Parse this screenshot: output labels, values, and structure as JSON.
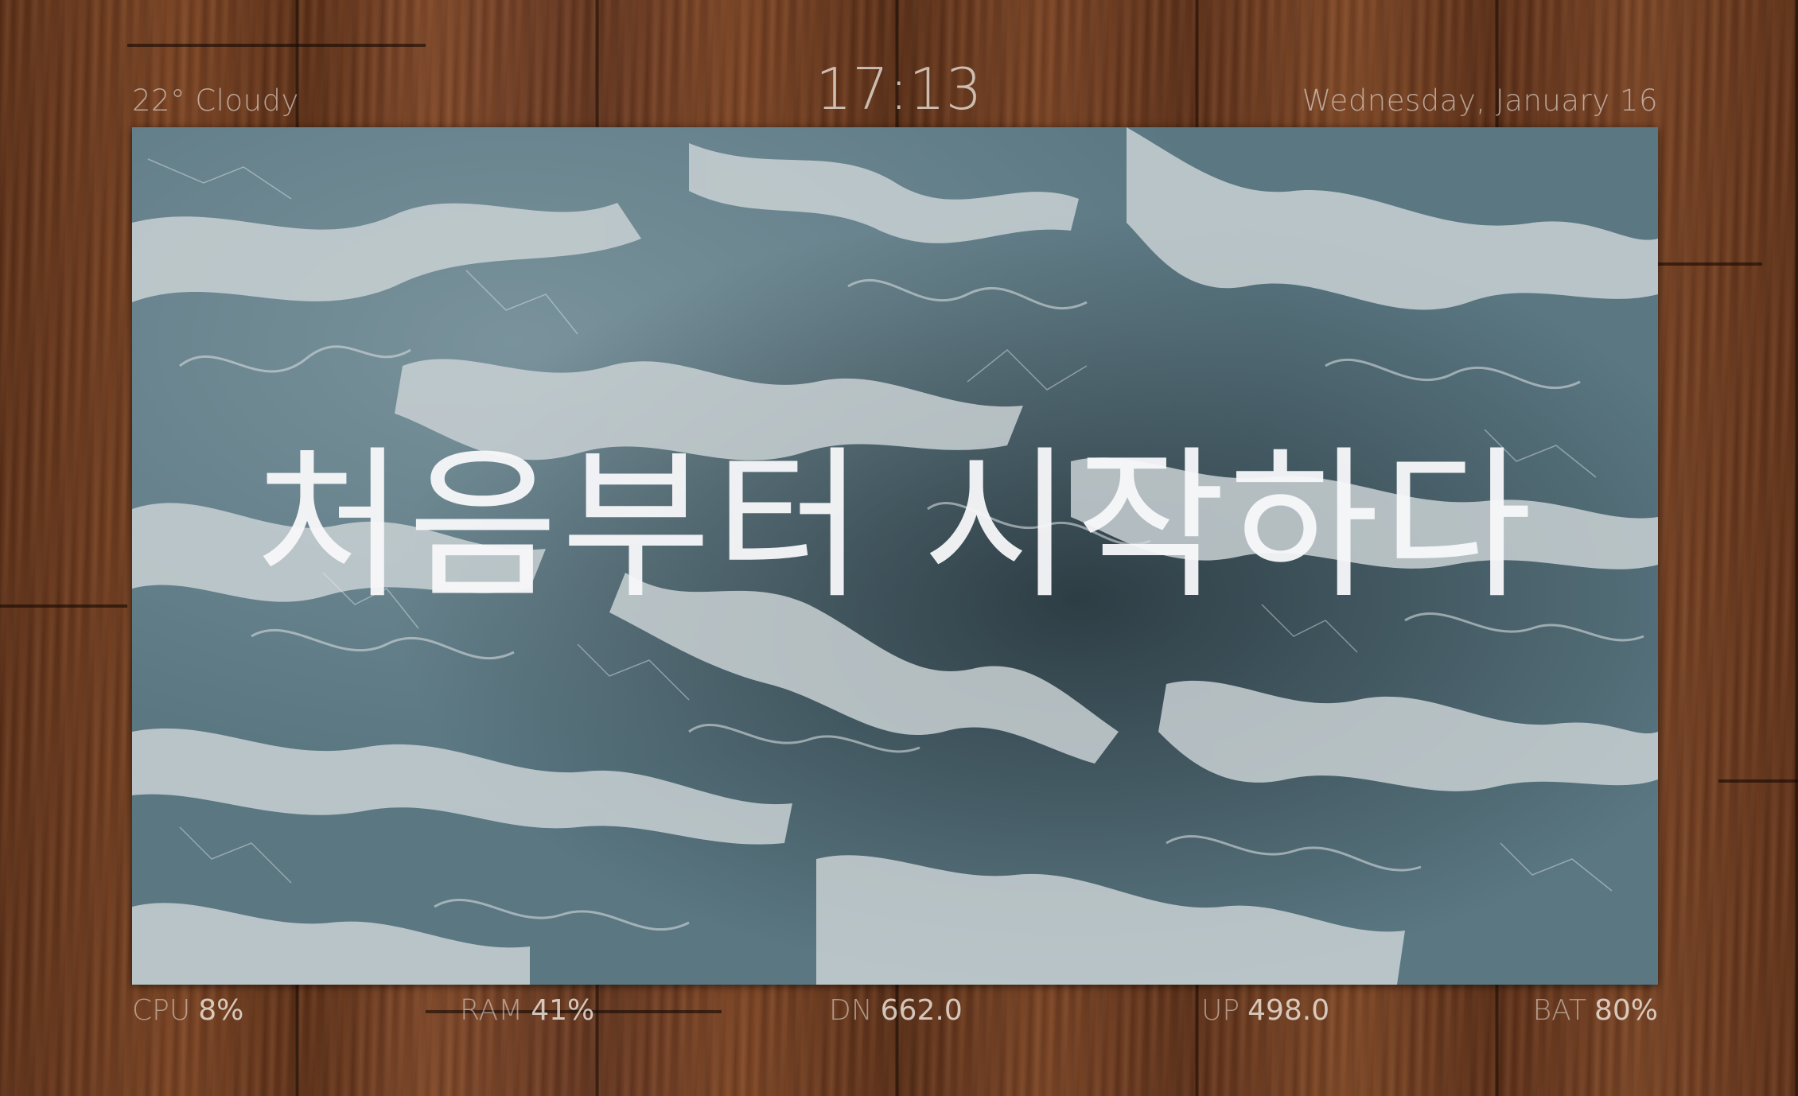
{
  "weather": {
    "text": "22° Cloudy"
  },
  "clock": {
    "time": "17:13"
  },
  "date": {
    "text": "Wednesday, January 16"
  },
  "wallpaper": {
    "headline": "처음부터 시작하다"
  },
  "stats": {
    "cpu": {
      "label": "CPU",
      "value": "8%"
    },
    "ram": {
      "label": "RAM",
      "value": "41%"
    },
    "dn": {
      "label": "DN",
      "value": "662.0"
    },
    "up": {
      "label": "UP",
      "value": "498.0"
    },
    "bat": {
      "label": "BAT",
      "value": "80%"
    }
  },
  "colors": {
    "desk_wood": "#6b3b1f",
    "wallpaper_water": "#56727d",
    "foam": "#c8d0d3",
    "text": "#ebe4dc"
  }
}
